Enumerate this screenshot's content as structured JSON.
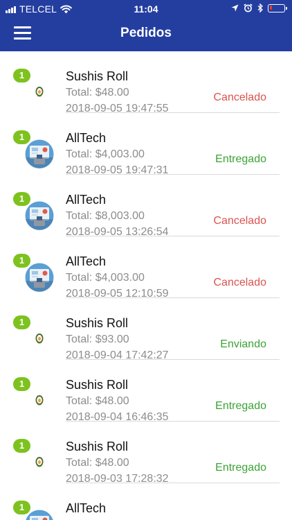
{
  "status_bar": {
    "carrier": "TELCEL",
    "time": "11:04",
    "battery_level": 0.15,
    "battery_color": "#e83a3a"
  },
  "header": {
    "title": "Pedidos",
    "menu_icon": "hamburger-menu-icon",
    "background": "#243ea0"
  },
  "colors": {
    "badge": "#7dc21e",
    "cancelled": "#d9534f",
    "green_status": "#3aa335"
  },
  "orders": [
    {
      "badge": "1",
      "store": "Sushis Roll",
      "total": "Total: $48.00",
      "date": "2018-09-05 19:47:55",
      "status": "Cancelado",
      "status_color": "#d9534f",
      "avatar": "sushi-icon"
    },
    {
      "badge": "1",
      "store": "AllTech",
      "total": "Total: $4,003.00",
      "date": "2018-09-05 19:47:31",
      "status": "Entregado",
      "status_color": "#3aa335",
      "avatar": "tech-store-icon"
    },
    {
      "badge": "1",
      "store": "AllTech",
      "total": "Total: $8,003.00",
      "date": "2018-09-05 13:26:54",
      "status": "Cancelado",
      "status_color": "#d9534f",
      "avatar": "tech-store-icon"
    },
    {
      "badge": "1",
      "store": "AllTech",
      "total": "Total: $4,003.00",
      "date": "2018-09-05 12:10:59",
      "status": "Cancelado",
      "status_color": "#d9534f",
      "avatar": "tech-store-icon"
    },
    {
      "badge": "1",
      "store": "Sushis Roll",
      "total": "Total: $93.00",
      "date": "2018-09-04 17:42:27",
      "status": "Enviando",
      "status_color": "#3aa335",
      "avatar": "sushi-icon"
    },
    {
      "badge": "1",
      "store": "Sushis Roll",
      "total": "Total: $48.00",
      "date": "2018-09-04 16:46:35",
      "status": "Entregado",
      "status_color": "#3aa335",
      "avatar": "sushi-icon"
    },
    {
      "badge": "1",
      "store": "Sushis Roll",
      "total": "Total: $48.00",
      "date": "2018-09-03 17:28:32",
      "status": "Entregado",
      "status_color": "#3aa335",
      "avatar": "sushi-icon"
    },
    {
      "badge": "1",
      "store": "AllTech",
      "total": "",
      "date": "",
      "status": "",
      "status_color": "#3aa335",
      "avatar": "tech-store-icon"
    }
  ]
}
